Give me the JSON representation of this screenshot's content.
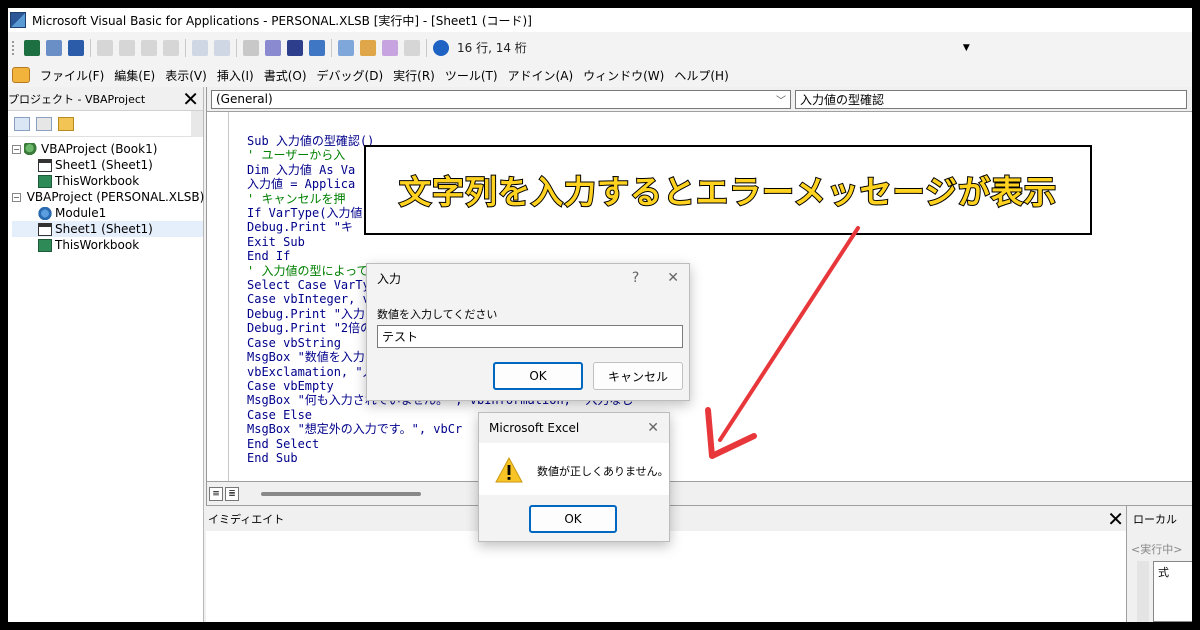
{
  "window": {
    "title": "Microsoft Visual Basic for Applications - PERSONAL.XLSB [実行中] - [Sheet1 (コード)]"
  },
  "toolbar": {
    "position_text": "16 行, 14 桁",
    "icons": [
      "excel-icon",
      "insert-form-icon",
      "save-icon",
      "cut-icon",
      "copy-icon",
      "paste-icon",
      "find-icon",
      "undo-icon",
      "redo-icon",
      "run-icon",
      "break-icon",
      "reset-icon",
      "design-mode-icon",
      "project-explorer-icon",
      "properties-icon",
      "object-browser-icon",
      "toolbox-icon",
      "help-icon"
    ]
  },
  "menu": {
    "items": [
      "ファイル(F)",
      "編集(E)",
      "表示(V)",
      "挿入(I)",
      "書式(O)",
      "デバッグ(D)",
      "実行(R)",
      "ツール(T)",
      "アドイン(A)",
      "ウィンドウ(W)",
      "ヘルプ(H)"
    ]
  },
  "project": {
    "title": "プロジェクト - VBAProject",
    "close": "✕",
    "tree": [
      {
        "label": "VBAProject (Book1)",
        "level": 0,
        "icon": "project-icon",
        "toggle": "−"
      },
      {
        "label": "Sheet1 (Sheet1)",
        "level": 1,
        "icon": "sheet-icon"
      },
      {
        "label": "ThisWorkbook",
        "level": 1,
        "icon": "workbook-icon"
      },
      {
        "label": "VBAProject (PERSONAL.XLSB)",
        "level": 0,
        "icon": "project-icon",
        "toggle": "−"
      },
      {
        "label": "Module1",
        "level": 1,
        "icon": "module-icon"
      },
      {
        "label": "Sheet1 (Sheet1)",
        "level": 1,
        "icon": "sheet-icon"
      },
      {
        "label": "ThisWorkbook",
        "level": 1,
        "icon": "workbook-icon"
      }
    ]
  },
  "code": {
    "object_combo": "(General)",
    "proc_combo": "入力値の型確認",
    "lines": [
      {
        "text": "Sub 入力値の型確認()",
        "comment": false
      },
      {
        "text": "' ユーザーから入",
        "comment": true
      },
      {
        "text": "Dim 入力値 As Va",
        "comment": false
      },
      {
        "text": "入力値 = Applica",
        "comment": false
      },
      {
        "text": "' キャンセルを押",
        "comment": true
      },
      {
        "text": "If VarType(入力値",
        "comment": false
      },
      {
        "text": "Debug.Print \"キ",
        "comment": false
      },
      {
        "text": "Exit Sub",
        "comment": false
      },
      {
        "text": "End If",
        "comment": false
      },
      {
        "text": "' 入力値の型によって処理を分岐",
        "comment": true
      },
      {
        "text": "Select Case VarTy",
        "comment": false
      },
      {
        "text": "Case vbInteger, v",
        "comment": false
      },
      {
        "text": "Debug.Print \"入力",
        "comment": false
      },
      {
        "text": "Debug.Print \"2倍の",
        "comment": false
      },
      {
        "text": "Case vbString",
        "comment": false
      },
      {
        "text": "MsgBox \"数値を入力                              できません。\", _",
        "comment": false
      },
      {
        "text": "vbExclamation, \"入",
        "comment": false
      },
      {
        "text": "Case vbEmpty",
        "comment": false
      },
      {
        "text": "MsgBox \"何も入力されていません。\", vbInformation, \"入力なし\"",
        "comment": false
      },
      {
        "text": "Case Else",
        "comment": false
      },
      {
        "text": "MsgBox \"想定外の入力です。\", vbCr",
        "comment": false
      },
      {
        "text": "End Select",
        "comment": false
      },
      {
        "text": "End Sub",
        "comment": false
      }
    ]
  },
  "callout": {
    "text": "文字列を入力するとエラーメッセージが表示"
  },
  "input_dialog": {
    "title": "入力",
    "help": "?",
    "close": "✕",
    "prompt": "数値を入力してください",
    "value": "テスト",
    "ok": "OK",
    "cancel": "キャンセル"
  },
  "msg_dialog": {
    "title": "Microsoft Excel",
    "close": "✕",
    "message": "数値が正しくありません。",
    "ok": "OK"
  },
  "immediate": {
    "title": "イミディエイト",
    "close": "✕"
  },
  "locals": {
    "title": "ローカル",
    "status": "<実行中>",
    "column": "式"
  },
  "colors": {
    "code_keyword": "#00008b",
    "code_comment": "#008000",
    "callout_text": "#ffd21f",
    "arrow": "#e8373b",
    "accent": "#0067c0"
  }
}
